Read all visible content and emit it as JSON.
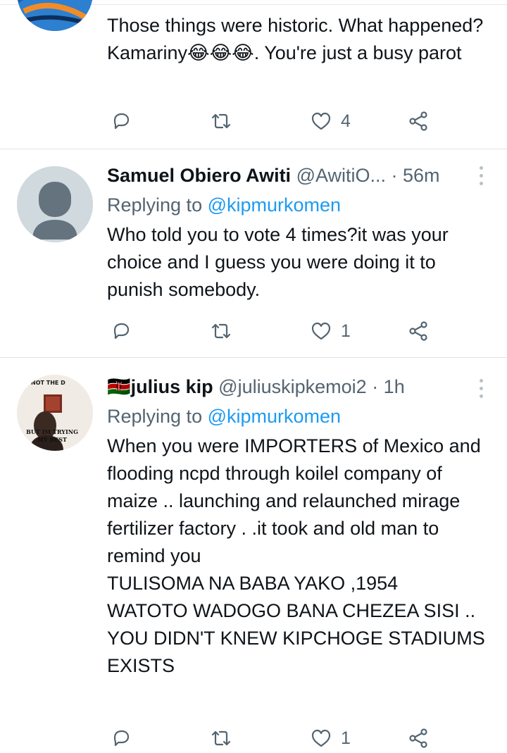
{
  "tweets": [
    {
      "text_before": "Those things were historic. What happened? Kamariny",
      "emoji": "😂😂😂",
      "text_after": ". You're just a busy parot",
      "likes": "4"
    },
    {
      "name": "Samuel Obiero Awiti",
      "handle": "@AwitiO...",
      "time": "· 56m",
      "replying_label": "Replying to",
      "replying_to": "@kipmurkomen",
      "text": "Who told you to vote 4 times?it was your choice and I guess you were doing it to punish somebody.",
      "likes": "1"
    },
    {
      "name_flag": "🇰🇪",
      "name": "julius kip",
      "handle": "@juliuskipkemoi2",
      "time": "· 1h",
      "avatar_text_top": "NOT THE D",
      "avatar_text_bottom": "BUT IM TRYING MY BEST",
      "replying_label": "Replying to",
      "replying_to": "@kipmurkomen",
      "text": "When you were IMPORTERS of Mexico and flooding ncpd through koilel company of maize .. launching and relaunched mirage fertilizer factory . .it took and old man to remind you\nTULISOMA NA BABA YAKO ,1954\nWATOTO WADOGO BANA CHEZEA SISI ..\nYOU DIDN'T KNEW KIPCHOGE STADIUMS EXISTS",
      "likes": "1"
    }
  ],
  "icons": {
    "reply": "reply-icon",
    "retweet": "retweet-icon",
    "like": "heart-icon",
    "share": "share-icon",
    "more": "more-icon"
  },
  "colors": {
    "link": "#1d9bf0",
    "secondary": "#536471",
    "text": "#0f1419"
  }
}
